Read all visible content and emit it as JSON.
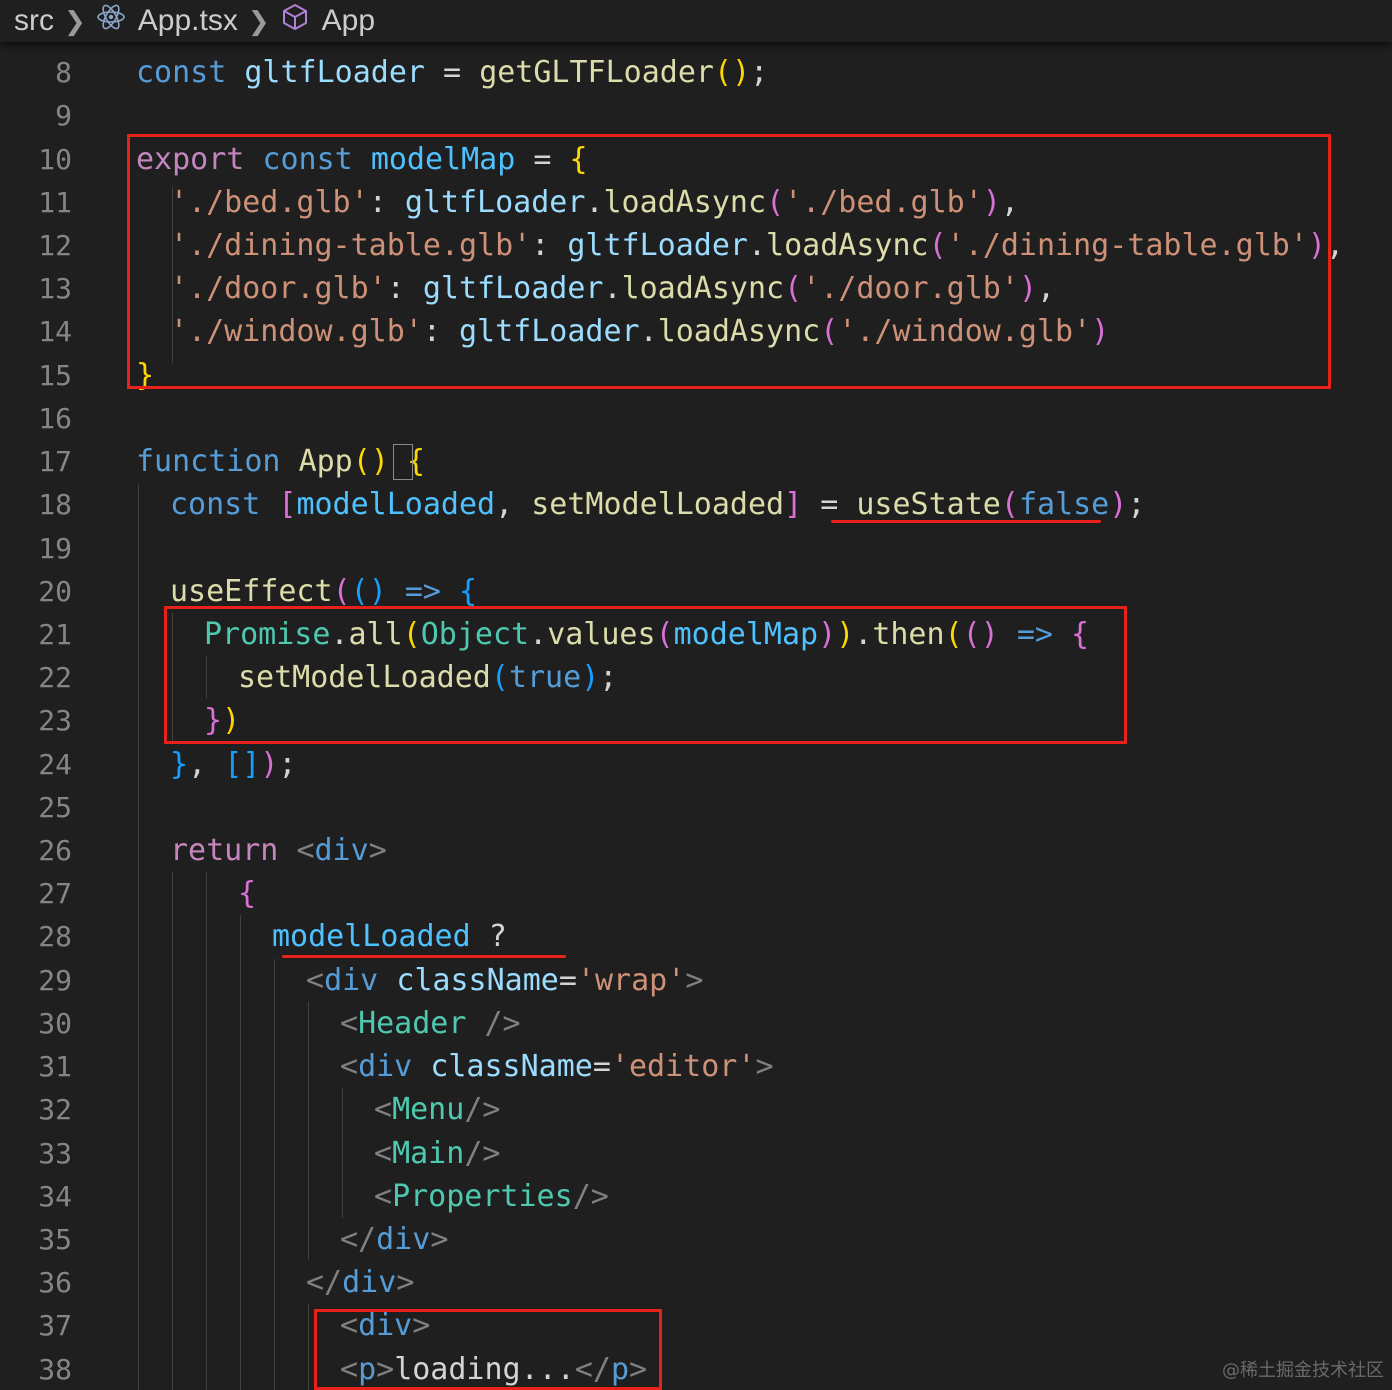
{
  "breadcrumb": {
    "items": [
      {
        "label": "src",
        "icon": "none"
      },
      {
        "label": "App.tsx",
        "icon": "react-icon"
      },
      {
        "label": "App",
        "icon": "cube-icon"
      }
    ],
    "separator": ">"
  },
  "editor": {
    "line_numbers": [
      "8",
      "9",
      "10",
      "11",
      "12",
      "13",
      "14",
      "15",
      "16",
      "17",
      "18",
      "19",
      "20",
      "21",
      "22",
      "23",
      "24",
      "25",
      "26",
      "27",
      "28",
      "29",
      "30",
      "31",
      "32",
      "33",
      "34",
      "35",
      "36",
      "37",
      "38"
    ],
    "highlight_color": "#e8221b",
    "code": {
      "l8": [
        "const",
        " ",
        "gltfLoader",
        " = ",
        "getGLTFLoader",
        "(",
        ")",
        ";"
      ],
      "l10": [
        "export",
        " ",
        "const",
        " ",
        "modelMap",
        " = ",
        "{"
      ],
      "l11": [
        "'./bed.glb'",
        ": ",
        "gltfLoader",
        ".",
        "loadAsync",
        "(",
        "'./bed.glb'",
        ")",
        ","
      ],
      "l12": [
        "'./dining-table.glb'",
        ": ",
        "gltfLoader",
        ".",
        "loadAsync",
        "(",
        "'./dining-table.glb'",
        ")",
        ","
      ],
      "l13": [
        "'./door.glb'",
        ": ",
        "gltfLoader",
        ".",
        "loadAsync",
        "(",
        "'./door.glb'",
        ")",
        ","
      ],
      "l14": [
        "'./window.glb'",
        ": ",
        "gltfLoader",
        ".",
        "loadAsync",
        "(",
        "'./window.glb'",
        ")"
      ],
      "l15": [
        "}"
      ],
      "l17": [
        "function",
        " ",
        "App",
        "(",
        ")",
        " ",
        "{"
      ],
      "l18": [
        "const",
        " ",
        "[",
        "modelLoaded",
        ", ",
        "setModelLoaded",
        "]",
        " = ",
        "useState",
        "(",
        "false",
        ")",
        ";"
      ],
      "l20": [
        "useEffect",
        "(",
        "(",
        ")",
        " ",
        "=>",
        " ",
        "{"
      ],
      "l21": [
        "Promise",
        ".",
        "all",
        "(",
        "Object",
        ".",
        "values",
        "(",
        "modelMap",
        ")",
        ")",
        ".",
        "then",
        "(",
        "(",
        ")",
        " ",
        "=>",
        " ",
        "{"
      ],
      "l22": [
        "setModelLoaded",
        "(",
        "true",
        ")",
        ";"
      ],
      "l23": [
        "}",
        ")"
      ],
      "l24": [
        "}",
        ", ",
        "[",
        "]",
        ")",
        ";"
      ],
      "l26": [
        "return",
        " ",
        "<",
        "div",
        ">"
      ],
      "l27": [
        "{"
      ],
      "l28": [
        "modelLoaded",
        " ?"
      ],
      "l29": [
        "<",
        "div",
        " ",
        "className",
        "=",
        "'wrap'",
        ">"
      ],
      "l30": [
        "<",
        "Header",
        " />"
      ],
      "l31": [
        "<",
        "div",
        " ",
        "className",
        "=",
        "'editor'",
        ">"
      ],
      "l32": [
        "<",
        "Menu",
        "/>"
      ],
      "l33": [
        "<",
        "Main",
        "/>"
      ],
      "l34": [
        "<",
        "Properties",
        "/>"
      ],
      "l35": [
        "</",
        "div",
        ">"
      ],
      "l36": [
        "</",
        "div",
        ">"
      ],
      "l37": [
        "<",
        "div",
        ">"
      ],
      "l38": [
        "<",
        "p",
        ">",
        "loading...",
        "</",
        "p",
        ">"
      ]
    }
  },
  "watermark": "@稀土掘金技术社区"
}
